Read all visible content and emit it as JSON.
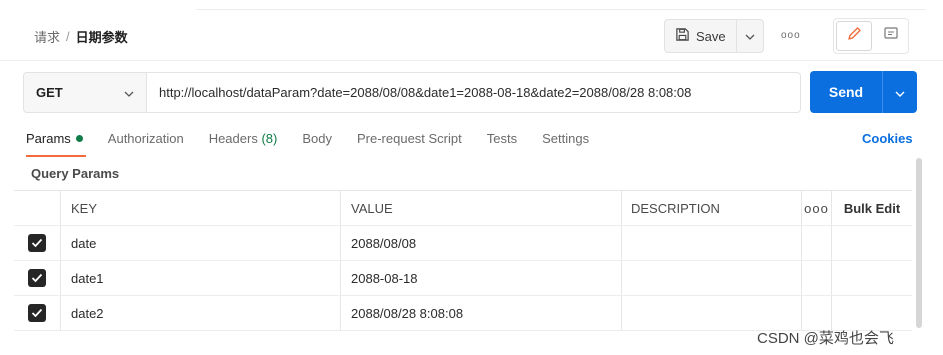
{
  "breadcrumb": {
    "parent": "请求",
    "separator": "/",
    "current": "日期参数"
  },
  "toolbar": {
    "save_label": "Save",
    "more_label": "ooo"
  },
  "request": {
    "method": "GET",
    "url": "http://localhost/dataParam?date=2088/08/08&date1=2088-08-18&date2=2088/08/28 8:08:08",
    "send_label": "Send"
  },
  "tabs": [
    {
      "label": "Params",
      "active": true
    },
    {
      "label": "Authorization"
    },
    {
      "label": "Headers",
      "count": "(8)"
    },
    {
      "label": "Body"
    },
    {
      "label": "Pre-request Script"
    },
    {
      "label": "Tests"
    },
    {
      "label": "Settings"
    }
  ],
  "cookies_label": "Cookies",
  "section_title": "Query Params",
  "table": {
    "headers": {
      "key": "KEY",
      "value": "VALUE",
      "description": "DESCRIPTION",
      "more": "ooo",
      "bulk_edit": "Bulk Edit"
    },
    "rows": [
      {
        "checked": true,
        "key": "date",
        "value": "2088/08/08",
        "description": ""
      },
      {
        "checked": true,
        "key": "date1",
        "value": "2088-08-18",
        "description": ""
      },
      {
        "checked": true,
        "key": "date2",
        "value": "2088/08/28 8:08:08",
        "description": ""
      }
    ]
  },
  "watermark": "CSDN @菜鸡也会飞",
  "colors": {
    "send": "#0b6fe0",
    "active_tab_underline": "#f26b3a",
    "params_dot": "#0f7b47",
    "cookies": "#0b6fe0"
  }
}
